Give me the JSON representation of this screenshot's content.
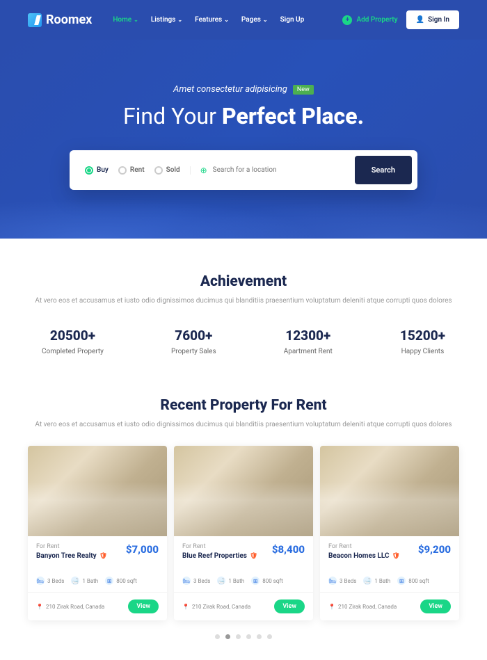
{
  "header": {
    "logo": "Roomex",
    "nav": [
      {
        "label": "Home",
        "active": true,
        "caret": true
      },
      {
        "label": "Listings",
        "active": false,
        "caret": true
      },
      {
        "label": "Features",
        "active": false,
        "caret": true
      },
      {
        "label": "Pages",
        "active": false,
        "caret": true
      },
      {
        "label": "Sign Up",
        "active": false,
        "caret": false
      }
    ],
    "add_property": "Add Property",
    "sign_in": "Sign In"
  },
  "hero": {
    "tagline": "Amet consectetur adipisicing",
    "badge": "New",
    "title_prefix": "Find Your ",
    "title_bold": "Perfect Place.",
    "search_types": [
      {
        "label": "Buy",
        "active": true
      },
      {
        "label": "Rent",
        "active": false
      },
      {
        "label": "Sold",
        "active": false
      }
    ],
    "search_placeholder": "Search for a location",
    "search_btn": "Search"
  },
  "achieve": {
    "title": "Achievement",
    "desc": "At vero eos et accusamus et iusto odio dignissimos ducimus qui blanditiis praesentium voluptatum deleniti atque corrupti quos dolores",
    "stats": [
      {
        "num": "20500+",
        "label": "Completed Property"
      },
      {
        "num": "7600+",
        "label": "Property Sales"
      },
      {
        "num": "12300+",
        "label": "Apartment Rent"
      },
      {
        "num": "15200+",
        "label": "Happy Clients"
      }
    ]
  },
  "recent": {
    "title": "Recent Property For Rent",
    "desc": "At vero eos et accusamus et iusto odio dignissimos ducimus qui blanditiis praesentium voluptatum deleniti atque corrupti quos dolores",
    "cards": [
      {
        "tag": "For Rent",
        "price": "$7,000",
        "title": "Banyon Tree Realty",
        "beds": "3 Beds",
        "bath": "1 Bath",
        "sqft": "800 sqft",
        "addr": "210 Zirak Road, Canada",
        "view": "View"
      },
      {
        "tag": "For Rent",
        "price": "$8,400",
        "title": "Blue Reef Properties",
        "beds": "3 Beds",
        "bath": "1 Bath",
        "sqft": "800 sqft",
        "addr": "210 Zirak Road, Canada",
        "view": "View"
      },
      {
        "tag": "For Rent",
        "price": "$9,200",
        "title": "Beacon Homes LLC",
        "beds": "3 Beds",
        "bath": "1 Bath",
        "sqft": "800 sqft",
        "addr": "210 Zirak Road, Canada",
        "view": "View"
      }
    ]
  }
}
